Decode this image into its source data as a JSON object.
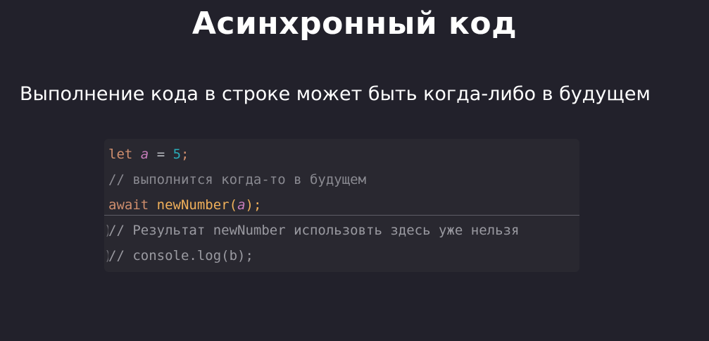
{
  "slide": {
    "title": "Асинхронный код",
    "subtitle": "Выполнение кода в строке может быть когда-либо в будущем"
  },
  "code": {
    "line1": {
      "keyword": "let",
      "variable": "a",
      "operator": "=",
      "number": "5",
      "terminator": ";"
    },
    "line2": {
      "comment": "// выполнится когда-то в будущем"
    },
    "line3": {
      "keyword": "await",
      "function": "newNumber",
      "open_paren": "(",
      "argument": "a",
      "close_paren": ");"
    },
    "line4": {
      "comment": "// Результат newNumber использовть здесь уже нельзя"
    },
    "line5": {
      "comment": "// console.log(b);"
    }
  },
  "colors": {
    "background": "#22212b",
    "code_background": "#292830",
    "keyword": "#cf8e6d",
    "variable": "#c77dbb",
    "number": "#2aacb8",
    "function": "#f0b05a",
    "comment": "#8a8a91"
  }
}
